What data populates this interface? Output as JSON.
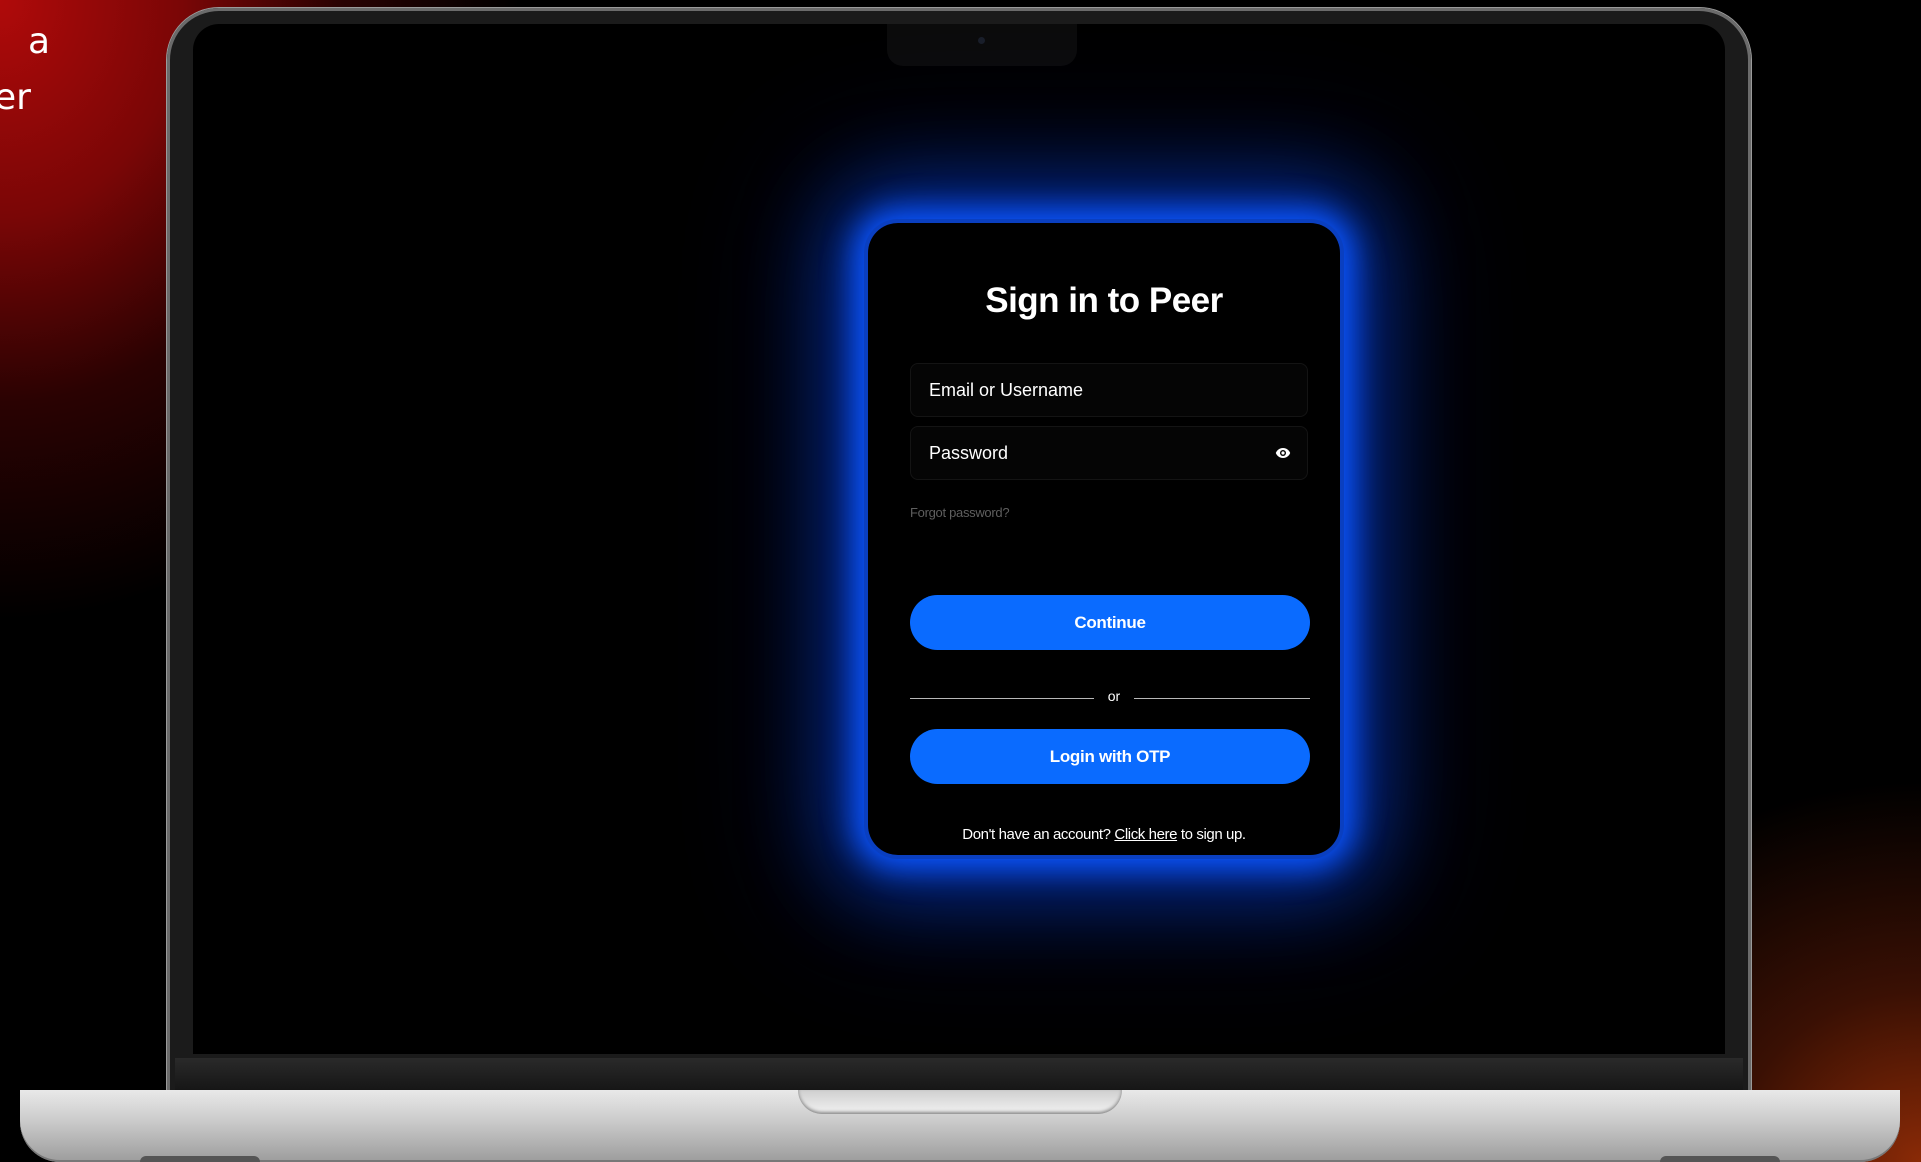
{
  "side_text": {
    "line1": "a",
    "line2": "er"
  },
  "login": {
    "title": "Sign in to Peer",
    "email_placeholder": "Email or Username",
    "password_placeholder": "Password",
    "password_toggle_icon": "eye-icon",
    "forgot_password": "Forgot password?",
    "continue_label": "Continue",
    "divider_text": "or",
    "otp_label": "Login with OTP",
    "signup_prefix": "Don't have an account?",
    "signup_link": "Click here",
    "signup_suffix": "to sign up."
  },
  "colors": {
    "accent": "#0a6bff",
    "glow": "#0b55ff",
    "card_bg": "#000000",
    "backdrop_red": "#b00a0a"
  }
}
